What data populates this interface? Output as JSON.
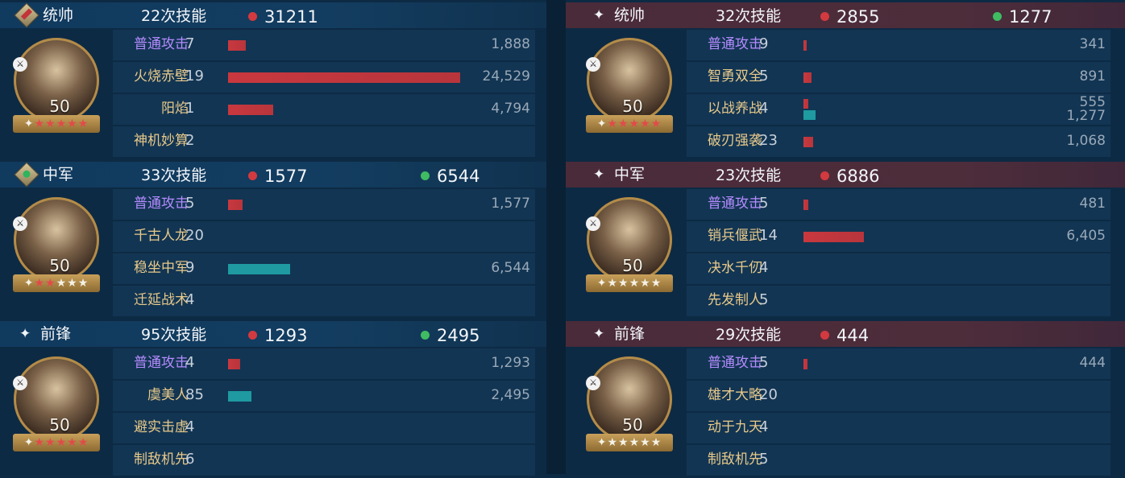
{
  "left": [
    {
      "role": "统帅",
      "count_label": "22次技能",
      "red": "31211",
      "green": null,
      "level": "50",
      "stars_red": 5,
      "stars_total": 6,
      "skills": [
        {
          "name": "普通攻击",
          "num": "7",
          "color": "purple",
          "bar": "red",
          "fill": 0.077,
          "value": "1,888"
        },
        {
          "name": "火烧赤壁",
          "num": "19",
          "color": "gold",
          "bar": "red",
          "fill": 1.0,
          "value": "24,529"
        },
        {
          "name": "阳焰",
          "num": "1",
          "color": "gold",
          "bar": "red",
          "fill": 0.195,
          "value": "4,794"
        },
        {
          "name": "神机妙算",
          "num": "2",
          "color": "gold",
          "bar": null,
          "fill": 0,
          "value": ""
        }
      ]
    },
    {
      "role": "中军",
      "count_label": "33次技能",
      "red": "1577",
      "green": "6544",
      "level": "50",
      "stars_red": 2,
      "stars_total": 6,
      "skills": [
        {
          "name": "普通攻击",
          "num": "5",
          "color": "purple",
          "bar": "red",
          "fill": 0.064,
          "value": "1,577"
        },
        {
          "name": "千古人龙",
          "num": "20",
          "color": "gold",
          "bar": null,
          "fill": 0,
          "value": ""
        },
        {
          "name": "稳坐中军",
          "num": "9",
          "color": "gold",
          "bar": "teal",
          "fill": 0.267,
          "value": "6,544"
        },
        {
          "name": "迁延战术",
          "num": "4",
          "color": "gold",
          "bar": null,
          "fill": 0,
          "value": ""
        }
      ]
    },
    {
      "role": "前锋",
      "count_label": "95次技能",
      "red": "1293",
      "green": "2495",
      "level": "50",
      "stars_red": 5,
      "stars_total": 6,
      "skills": [
        {
          "name": "普通攻击",
          "num": "4",
          "color": "purple",
          "bar": "red",
          "fill": 0.053,
          "value": "1,293"
        },
        {
          "name": "虞美人",
          "num": "85",
          "color": "gold",
          "bar": "teal",
          "fill": 0.102,
          "value": "2,495"
        },
        {
          "name": "避实击虚",
          "num": "4",
          "color": "gold",
          "bar": null,
          "fill": 0,
          "value": ""
        },
        {
          "name": "制敌机先",
          "num": "6",
          "color": "gold",
          "bar": null,
          "fill": 0,
          "value": ""
        }
      ]
    }
  ],
  "right": [
    {
      "role": "统帅",
      "count_label": "32次技能",
      "red": "2855",
      "green": "1277",
      "level": "50",
      "stars_red": 5,
      "stars_total": 6,
      "skills": [
        {
          "name": "普通攻击",
          "num": "9",
          "color": "purple",
          "bar": "red",
          "fill": 0.013,
          "value": "341"
        },
        {
          "name": "智勇双全",
          "num": "5",
          "color": "gold",
          "bar": "red",
          "fill": 0.036,
          "value": "891"
        },
        {
          "name": "以战养战",
          "num": "4",
          "color": "gold",
          "bar": "dual",
          "fill": 0.022,
          "fill2": 0.052,
          "value": "555",
          "value2": "1,277"
        },
        {
          "name": "破刃强袭",
          "num": "23",
          "color": "gold",
          "bar": "red",
          "fill": 0.043,
          "value": "1,068"
        }
      ]
    },
    {
      "role": "中军",
      "count_label": "23次技能",
      "red": "6886",
      "green": null,
      "level": "50",
      "stars_red": 0,
      "stars_total": 6,
      "skills": [
        {
          "name": "普通攻击",
          "num": "5",
          "color": "purple",
          "bar": "red",
          "fill": 0.02,
          "value": "481"
        },
        {
          "name": "销兵偃武",
          "num": "14",
          "color": "gold",
          "bar": "red",
          "fill": 0.261,
          "value": "6,405"
        },
        {
          "name": "决水千仞",
          "num": "4",
          "color": "gold",
          "bar": null,
          "fill": 0,
          "value": ""
        },
        {
          "name": "先发制人",
          "num": "5",
          "color": "gold",
          "bar": null,
          "fill": 0,
          "value": ""
        }
      ]
    },
    {
      "role": "前锋",
      "count_label": "29次技能",
      "red": "444",
      "green": null,
      "level": "50",
      "stars_red": 0,
      "stars_total": 6,
      "skills": [
        {
          "name": "普通攻击",
          "num": "5",
          "color": "purple",
          "bar": "red",
          "fill": 0.018,
          "value": "444"
        },
        {
          "name": "雄才大略",
          "num": "20",
          "color": "gold",
          "bar": null,
          "fill": 0,
          "value": ""
        },
        {
          "name": "动于九天",
          "num": "4",
          "color": "gold",
          "bar": null,
          "fill": 0,
          "value": ""
        },
        {
          "name": "制敌机先",
          "num": "5",
          "color": "gold",
          "bar": null,
          "fill": 0,
          "value": ""
        }
      ]
    }
  ]
}
